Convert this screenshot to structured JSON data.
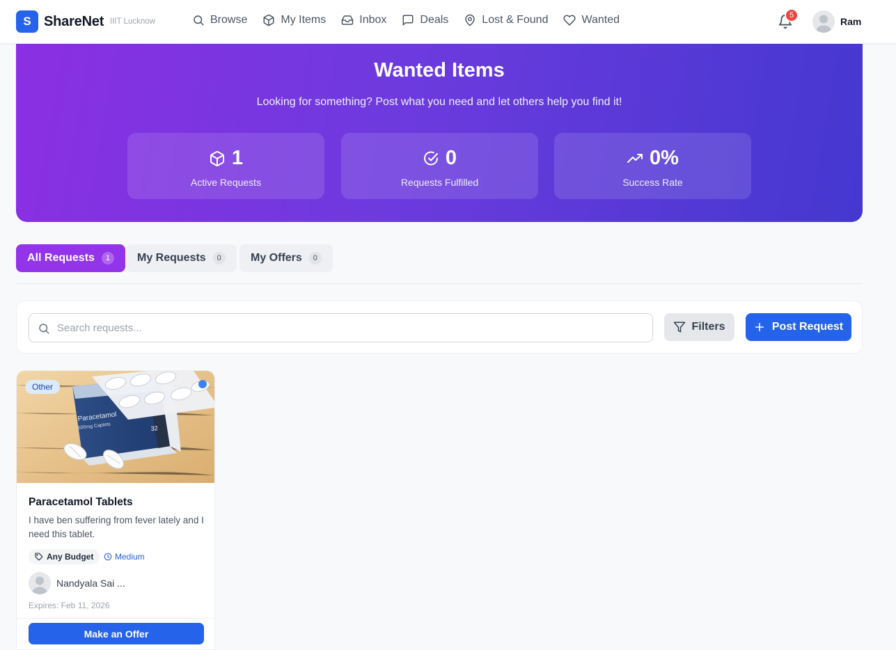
{
  "header": {
    "logo_letter": "S",
    "brand": "ShareNet",
    "campus": "IIIT Lucknow",
    "nav": [
      {
        "label": "Browse",
        "icon": "search-icon"
      },
      {
        "label": "My Items",
        "icon": "box-icon"
      },
      {
        "label": "Inbox",
        "icon": "inbox-icon"
      },
      {
        "label": "Deals",
        "icon": "message-icon"
      },
      {
        "label": "Lost & Found",
        "icon": "map-pin-icon"
      },
      {
        "label": "Wanted",
        "icon": "heart-icon"
      }
    ],
    "notification_count": "5",
    "user_name": "Ram"
  },
  "hero": {
    "title": "Wanted Items",
    "subtitle": "Looking for something? Post what you need and let others help you find it!",
    "stats": [
      {
        "value": "1",
        "label": "Active Requests",
        "icon": "box-icon"
      },
      {
        "value": "0",
        "label": "Requests Fulfilled",
        "icon": "check-circle-icon"
      },
      {
        "value": "0%",
        "label": "Success Rate",
        "icon": "trending-up-icon"
      }
    ]
  },
  "tabs": [
    {
      "label": "All Requests",
      "count": "1",
      "active": true
    },
    {
      "label": "My Requests",
      "count": "0",
      "active": false
    },
    {
      "label": "My Offers",
      "count": "0",
      "active": false
    }
  ],
  "toolbar": {
    "search_placeholder": "Search requests...",
    "filters_label": "Filters",
    "post_label": "Post Request"
  },
  "requests": [
    {
      "category": "Other",
      "title": "Paracetamol Tablets",
      "description": "I have ben suffering from fever lately and I need this tablet.",
      "budget": "Any Budget",
      "urgency": "Medium",
      "poster": "Nandyala Sai ...",
      "expires": "Expires: Feb 11, 2026",
      "action_label": "Make an Offer",
      "image_box_text": "Paracetamol",
      "image_box_sub": "500mg Caplets",
      "image_box_count": "32"
    }
  ],
  "colors": {
    "primary": "#2563eb",
    "accent_purple": "#9333ea",
    "hero_gradient_start": "#8b2fe3",
    "hero_gradient_end": "#4438cf",
    "notification_badge": "#ef4444"
  }
}
